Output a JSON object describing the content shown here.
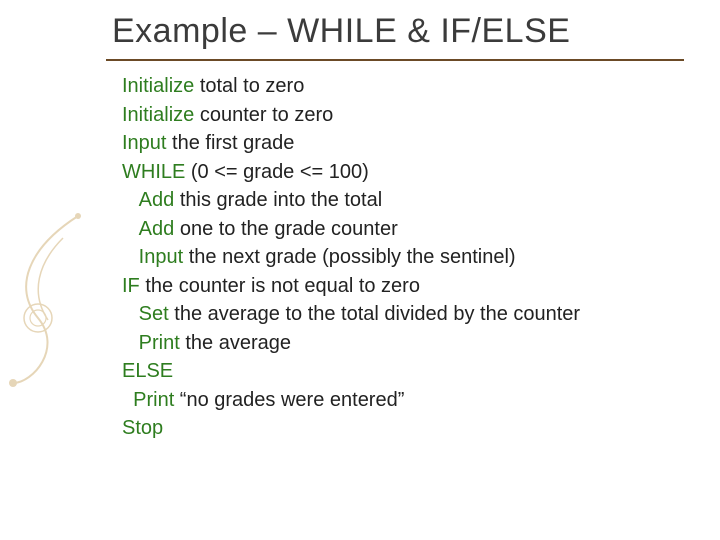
{
  "title": "Example – WHILE & IF/ELSE",
  "lines": [
    {
      "kw": "Initialize",
      "rest": " total to zero",
      "indent": 0
    },
    {
      "kw": "Initialize",
      "rest": " counter to zero",
      "indent": 0
    },
    {
      "kw": "Input",
      "rest": " the first grade",
      "indent": 0
    },
    {
      "kw": "WHILE",
      "rest": " (0 <= grade <= 100)",
      "indent": 0
    },
    {
      "kw": "Add",
      "rest": " this grade into the total",
      "indent": 1
    },
    {
      "kw": "Add",
      "rest": " one to the grade counter",
      "indent": 1
    },
    {
      "kw": "Input",
      "rest": " the next grade (possibly the sentinel)",
      "indent": 1
    },
    {
      "kw": "IF",
      "rest": " the counter is not equal to zero",
      "indent": 0
    },
    {
      "kw": "Set",
      "rest": " the average to the total divided by the counter",
      "indent": 1
    },
    {
      "kw": "Print",
      "rest": " the average",
      "indent": 1
    },
    {
      "kw": "ELSE",
      "rest": "",
      "indent": 0
    },
    {
      "kw": "Print",
      "rest": " “no grades were entered”",
      "indent": 0.6
    },
    {
      "kw": "Stop",
      "rest": "",
      "indent": 0
    }
  ]
}
